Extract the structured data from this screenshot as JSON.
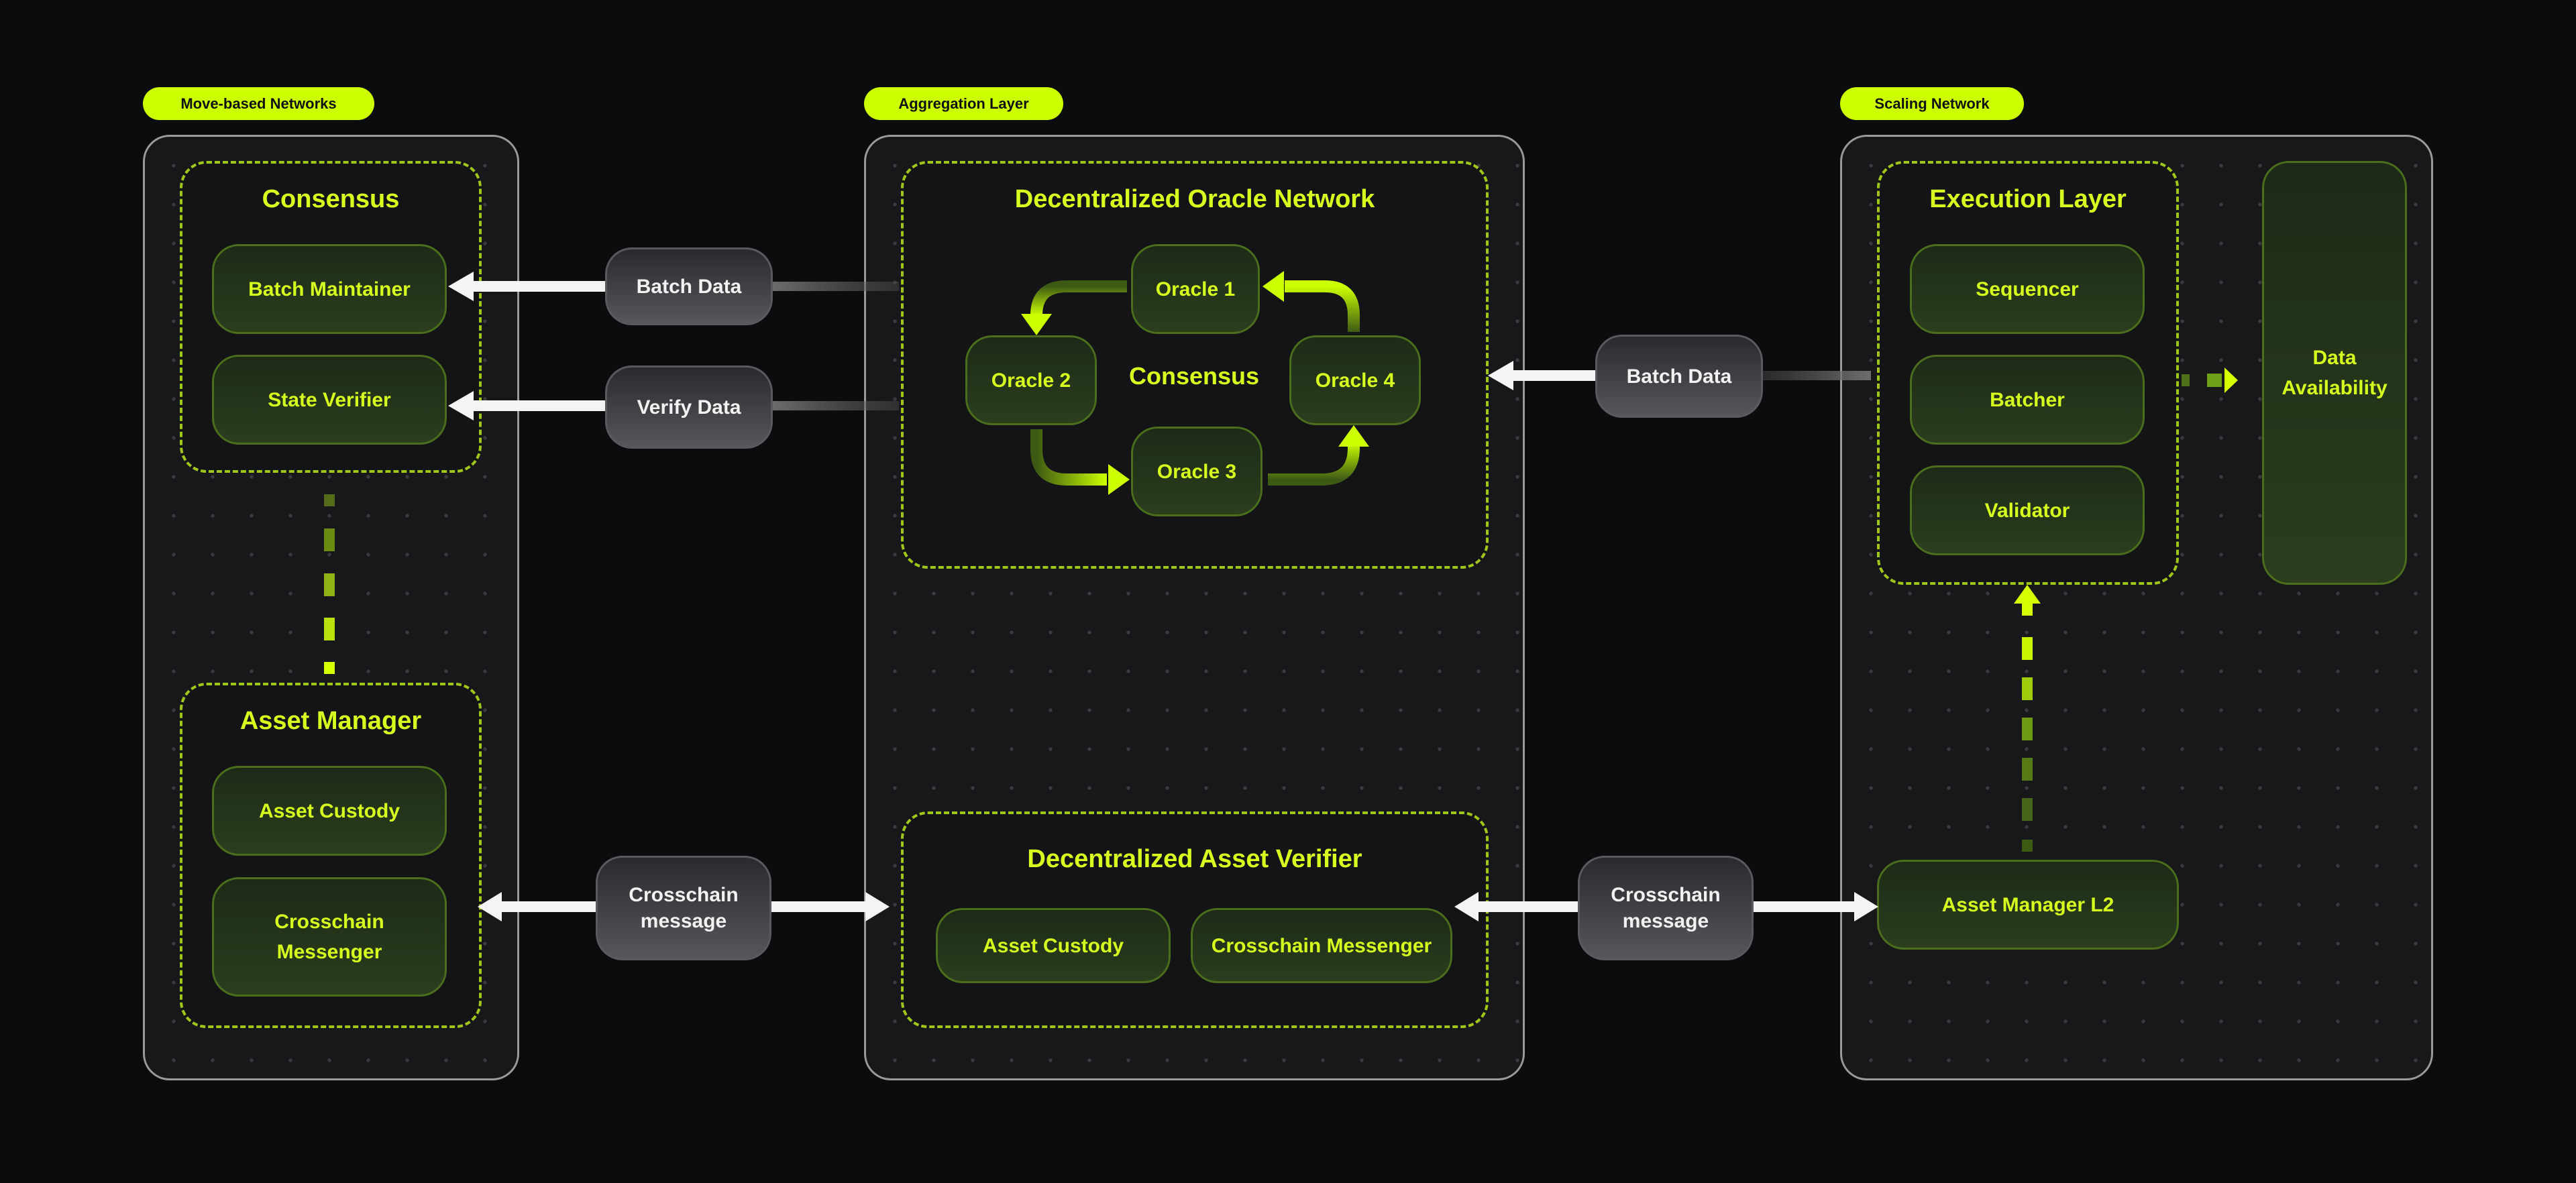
{
  "colors": {
    "accent": "#ccff00",
    "text_accent": "#d6ff1f",
    "background": "#0b0c0e",
    "panel": "#18181b",
    "node_border": "#4a6e1c",
    "message_text": "#f2f2f2"
  },
  "sections": {
    "left": {
      "label": "Move-based Networks",
      "consensus": {
        "title": "Consensus",
        "nodes": [
          "Batch Maintainer",
          "State Verifier"
        ]
      },
      "asset_manager": {
        "title": "Asset Manager",
        "nodes": [
          "Asset Custody",
          "Crosschain Messenger"
        ]
      }
    },
    "center": {
      "label": "Aggregation Layer",
      "oracle_network": {
        "title": "Decentralized Oracle Network",
        "center_label": "Consensus",
        "oracles": [
          "Oracle 1",
          "Oracle 2",
          "Oracle 3",
          "Oracle 4"
        ]
      },
      "asset_verifier": {
        "title": "Decentralized Asset Verifier",
        "nodes": [
          "Asset Custody",
          "Crosschain Messenger"
        ]
      }
    },
    "right": {
      "label": "Scaling Network",
      "execution_layer": {
        "title": "Execution Layer",
        "nodes": [
          "Sequencer",
          "Batcher",
          "Validator"
        ]
      },
      "data_availability": "Data Availability",
      "asset_manager_l2": "Asset Manager L2"
    }
  },
  "messages": {
    "batch_data_left": "Batch Data",
    "verify_data": "Verify Data",
    "batch_data_right": "Batch Data",
    "crosschain_left": "Crosschain message",
    "crosschain_right": "Crosschain message"
  }
}
